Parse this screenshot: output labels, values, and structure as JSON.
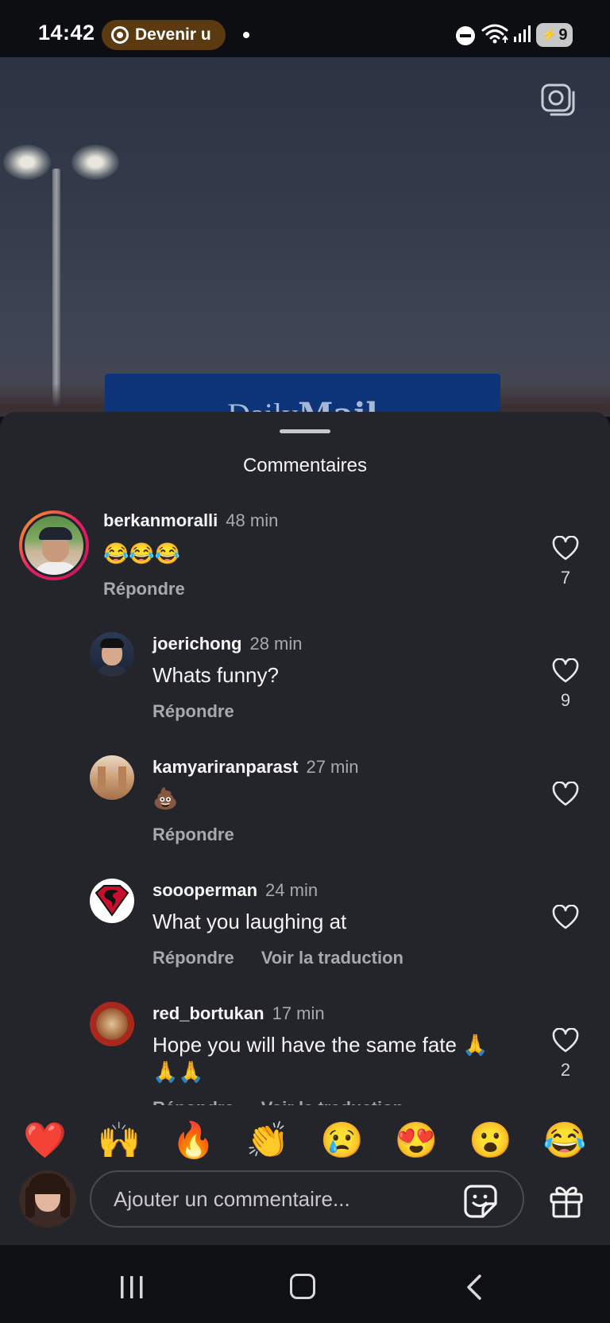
{
  "status_bar": {
    "time": "14:42",
    "pill_text": "Devenir u",
    "battery": "9",
    "icons": [
      "do-not-disturb-icon",
      "wifi-icon",
      "signal-icon",
      "battery-icon"
    ]
  },
  "video": {
    "banner_text_light": "Daily",
    "banner_text_bold": "Mail"
  },
  "sheet": {
    "title": "Commentaires"
  },
  "comments": [
    {
      "username": "berkanmoralli",
      "time": "48 min",
      "text": "😂😂😂",
      "reply": "Répondre",
      "translate": "",
      "likes": "7"
    },
    {
      "username": "joerichong",
      "time": "28 min",
      "text": "Whats funny?",
      "reply": "Répondre",
      "translate": "",
      "likes": "9"
    },
    {
      "username": "kamyariranparast",
      "time": "27 min",
      "text": "💩",
      "reply": "Répondre",
      "translate": "",
      "likes": ""
    },
    {
      "username": "soooperman",
      "time": "24 min",
      "text": "What you laughing at",
      "reply": "Répondre",
      "translate": "Voir la traduction",
      "likes": ""
    },
    {
      "username": "red_bortukan",
      "time": "17 min",
      "text_line1": "Hope you will have the same fate 🙏",
      "text_line2": "🙏🙏",
      "reply": "Répondre",
      "translate": "Voir la traduction",
      "likes": "2"
    }
  ],
  "emoji_bar": [
    "❤️",
    "🙌",
    "🔥",
    "👏",
    "😢",
    "😍",
    "😮",
    "😂"
  ],
  "input": {
    "placeholder": "Ajouter un commentaire..."
  },
  "colors": {
    "sheet_bg": "#24252b",
    "secondary_text": "#a8a9ae",
    "story_ring_start": "#f9a825",
    "story_ring_end": "#c2185b",
    "banner_blue": "#0d3378"
  }
}
